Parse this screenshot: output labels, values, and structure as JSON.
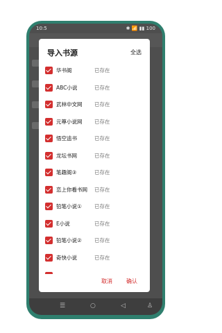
{
  "statusbar": {
    "time": "10:5",
    "icons": "✱ 📶 ▮▮ 100"
  },
  "dialog": {
    "title": "导入书源",
    "select_all": "全选",
    "cancel": "取消",
    "confirm": "确认",
    "accent_color": "#d32f2f",
    "items": [
      {
        "name": "华书阁",
        "status": "已存在",
        "checked": true
      },
      {
        "name": "ABC小说",
        "status": "已存在",
        "checked": true
      },
      {
        "name": "武林中文网",
        "status": "已存在",
        "checked": true
      },
      {
        "name": "元尊小说网",
        "status": "已存在",
        "checked": true
      },
      {
        "name": "悟空追书",
        "status": "已存在",
        "checked": true
      },
      {
        "name": "龙坛书网",
        "status": "已存在",
        "checked": true
      },
      {
        "name": "笔趣阁③",
        "status": "已存在",
        "checked": true
      },
      {
        "name": "恋上你看书网",
        "status": "已存在",
        "checked": true
      },
      {
        "name": "铅笔小说①",
        "status": "已存在",
        "checked": true
      },
      {
        "name": "E小说",
        "status": "已存在",
        "checked": true
      },
      {
        "name": "铅笔小说②",
        "status": "已存在",
        "checked": true
      },
      {
        "name": "奇快小说",
        "status": "已存在",
        "checked": true
      }
    ]
  },
  "navbar": {
    "icons": [
      "menu-icon",
      "home-icon",
      "back-icon",
      "person-icon"
    ]
  }
}
